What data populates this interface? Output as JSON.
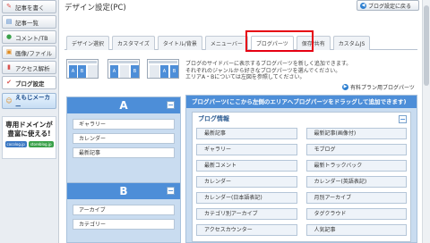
{
  "sidebar": {
    "items": [
      {
        "label": "記事を書く",
        "icon": "pencil-icon",
        "color": "#d9534f"
      },
      {
        "label": "記事一覧",
        "icon": "list-icon",
        "color": "#3b78c3"
      },
      {
        "label": "コメント/TB",
        "icon": "comment-icon",
        "color": "#3aa14a"
      },
      {
        "label": "画像/ファイル",
        "icon": "image-icon",
        "color": "#e08a1e"
      },
      {
        "label": "アクセス解析",
        "icon": "chart-icon",
        "color": "#d9534f"
      },
      {
        "label": "ブログ設定",
        "icon": "wrench-icon",
        "color": "#d9534f"
      }
    ],
    "emoji_button": "えもじメーカー",
    "ad": {
      "line1": "専用ドメインが",
      "line2": "豊富に使える!",
      "chips": [
        "cocolog.jp",
        "storeblog.jp"
      ]
    }
  },
  "header": {
    "title": "デザイン設定(PC)",
    "back_button": "ブログ設定に戻る"
  },
  "tabs": [
    "デザイン選択",
    "カスタマイズ",
    "タイトル/背景",
    "メニューバー",
    "ブログパーツ",
    "保存/共有",
    "カスタムJS"
  ],
  "active_tab": "ブログパーツ",
  "layouts": {
    "a": "A",
    "b": "B"
  },
  "description": {
    "line1": "ブログのサイドバーに表示するブログパーツを新しく追加できます。",
    "line2": "それぞれのジャンルから好きなブログパーツを選んでください。",
    "line3": "エリアA・Bについては左図を参照してください。"
  },
  "paid_link": "有料プラン用ブログパーツ",
  "area_a": {
    "label": "A",
    "items": [
      "ギャラリー",
      "カレンダー",
      "最新記事"
    ]
  },
  "area_b": {
    "label": "B",
    "items": [
      "アーカイブ",
      "カテゴリー"
    ]
  },
  "parts_panel": {
    "title": "ブログパーツ(ここから左側のエリアへブログパーツをドラッグして追加できます)",
    "section": "ブログ情報",
    "parts": [
      "最新記事",
      "最新記事(画像付)",
      "ギャラリー",
      "モブログ",
      "最新コメント",
      "最新トラックバック",
      "カレンダー",
      "カレンダー(英語表記)",
      "カレンダー(日本語表記)",
      "月別アーカイブ",
      "カテゴリ別アーカイブ",
      "タグクラウド",
      "アクセスカウンター",
      "人気記事"
    ]
  },
  "colors": {
    "accent": "#4d8ed8",
    "highlight": "#e60012",
    "area_bg": "#c9dcf0"
  }
}
